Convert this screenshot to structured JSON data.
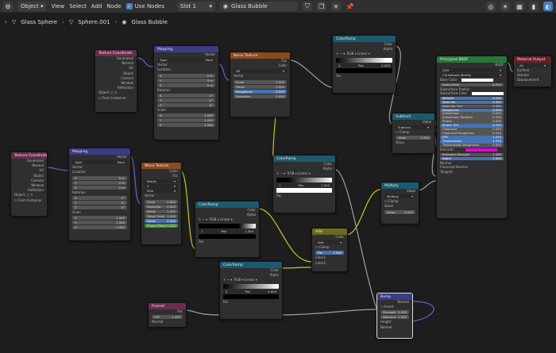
{
  "header": {
    "object_mode": "Object",
    "menus": [
      "View",
      "Select",
      "Add",
      "Node"
    ],
    "use_nodes_label": "Use Nodes",
    "slot": "Slot 1",
    "material_name": "Glass Bubble"
  },
  "breadcrumb": [
    "Glass Sphere",
    "Sphere.001",
    "Glass Bubble"
  ],
  "nodes": {
    "texcoord1": {
      "title": "Texture Coordinate",
      "outputs": [
        "Generated",
        "Normal",
        "UV",
        "Object",
        "Camera",
        "Window",
        "Reflection"
      ],
      "object_label": "Object:",
      "from_instancer": "From Instancer"
    },
    "mapping1": {
      "title": "Mapping",
      "out": "Vector",
      "type_label": "Type:",
      "type_value": "Point",
      "vector": "Vector",
      "location": "Location",
      "rotation": "Rotation",
      "scale": "Scale",
      "x": "X",
      "y": "Y",
      "z": "Z",
      "m0": "0 m",
      "deg0": "0°",
      "one": "1.000"
    },
    "noise1": {
      "title": "Noise Texture",
      "outputs": [
        "Fac",
        "Color"
      ],
      "dim": "3D",
      "vector": "Vector",
      "fields": [
        {
          "l": "Scale",
          "v": "5.000"
        },
        {
          "l": "Detail",
          "v": "2.000"
        },
        {
          "l": "Roughness",
          "v": "0.500"
        },
        {
          "l": "Distortion",
          "v": "0.000"
        }
      ]
    },
    "ramp_top": {
      "title": "ColorRamp",
      "outputs": [
        "Color",
        "Alpha"
      ],
      "mode": "RGB",
      "interp": "Linear",
      "pos": "Pos",
      "pos_val": "0.000",
      "idx": "0",
      "fac": "Fac"
    },
    "principled": {
      "title": "Principled BSDF",
      "out": "BSDF",
      "dist": "GGX",
      "sss": "Christensen-Burley",
      "rows": [
        "Base Color",
        "Subsurface",
        "Subsurface Radius",
        "Subsurface Color",
        "Metallic",
        "Specular",
        "Specular Tint",
        "Roughness",
        "Anisotropic",
        "Anisotropic Rotation",
        "Sheen",
        "Sheen Tint",
        "Clearcoat",
        "Clearcoat Roughness",
        "IOR",
        "Transmission",
        "Transmission Roughness",
        "Emission",
        "Emission Strength",
        "Alpha",
        "Normal",
        "Clearcoat Normal",
        "Tangent"
      ],
      "vals": [
        "",
        "0.000",
        "",
        "",
        "0.000",
        "0.500",
        "0.000",
        "0.000",
        "0.000",
        "0.000",
        "0.000",
        "0.500",
        "0.000",
        "0.030",
        "1.450",
        "1.000",
        "0.000",
        "",
        "1.000",
        "1.000",
        "",
        "",
        ""
      ]
    },
    "matout": {
      "title": "Material Output",
      "target": "All",
      "rows": [
        "Surface",
        "Volume",
        "Displacement"
      ]
    },
    "subtract": {
      "title": "Subtract",
      "out": "Value",
      "mode": "Subtract",
      "clamp": "Clamp",
      "value": "Value",
      "value_val": "1.000",
      "in": "Value"
    },
    "texcoord2": {
      "title": "Texture Coordinate",
      "outputs": [
        "Generated",
        "Normal",
        "UV",
        "Object",
        "Camera",
        "Window",
        "Reflection"
      ],
      "object_label": "Object:",
      "from_instancer": "From Instancer"
    },
    "mapping2": {
      "title": "Mapping",
      "out": "Vector",
      "type_label": "Type:",
      "type_value": "Point",
      "vector": "Vector",
      "location": "Location",
      "rotation": "Rotation",
      "scale": "Scale",
      "x": "X",
      "y": "Y",
      "z": "Z",
      "m0": "0 m",
      "deg0": "0°",
      "one": "1.000"
    },
    "wave": {
      "title": "Wave Texture",
      "outputs": [
        "Color",
        "Fac"
      ],
      "type": "Bands",
      "axis": "X",
      "profile": "Sine",
      "vector": "Vector",
      "fields": [
        {
          "l": "Scale",
          "v": "0.800"
        },
        {
          "l": "Distortion",
          "v": "0.000"
        },
        {
          "l": "Detail",
          "v": "2.000"
        },
        {
          "l": "Detail Scale",
          "v": "1.000"
        },
        {
          "l": "Detail Roughness",
          "v": "0.500"
        },
        {
          "l": "Phase Offset",
          "v": "0.000"
        }
      ]
    },
    "ramp_mid": {
      "title": "ColorRamp",
      "outputs": [
        "Color",
        "Alpha"
      ],
      "mode": "RGB",
      "interp": "Linear",
      "pos": "Pos",
      "pos_val": "1.000",
      "idx": "1",
      "fac": "Fac"
    },
    "ramp_low": {
      "title": "ColorRamp",
      "outputs": [
        "Color",
        "Alpha"
      ],
      "mode": "RGB",
      "interp": "Linear",
      "pos": "Pos",
      "pos_val": "1.000",
      "idx": "1",
      "fac": "Fac"
    },
    "add": {
      "title": "Add",
      "out": "Color",
      "mode": "Add",
      "clamp": "Clamp",
      "fac": "Fac",
      "fac_val": "1.000",
      "c1": "Color1",
      "c2": "Color2"
    },
    "multiply": {
      "title": "Multiply",
      "out": "Value",
      "mode": "Multiply",
      "clamp": "Clamp",
      "value": "Value",
      "value_val": "0.000",
      "in": "Value"
    },
    "ramp_bot": {
      "title": "ColorRamp",
      "outputs": [
        "Color",
        "Alpha"
      ],
      "mode": "RGB",
      "interp": "Linear",
      "pos": "Pos",
      "pos_val": "0.000",
      "idx": "0",
      "fac": "Fac"
    },
    "fresnel": {
      "title": "Fresnel",
      "out": "Fac",
      "ior": "IOR",
      "ior_val": "1.450",
      "normal": "Normal"
    },
    "bump": {
      "title": "Bump",
      "out": "Normal",
      "invert": "Invert",
      "rows": [
        {
          "l": "Strength",
          "v": "0.300"
        },
        {
          "l": "Distance",
          "v": "1.000"
        }
      ],
      "height": "Height",
      "normal": "Normal"
    }
  },
  "colors": {
    "texcoord": "#6a2d4b",
    "mapping": "#3b3b86",
    "texture": "#8a4b1e",
    "converter": "#1b5a6e",
    "shader": "#28763a",
    "output": "#6b1e24",
    "input": "#6a2d4b",
    "vector": "#3b3b86",
    "emission": "#e000e0"
  }
}
